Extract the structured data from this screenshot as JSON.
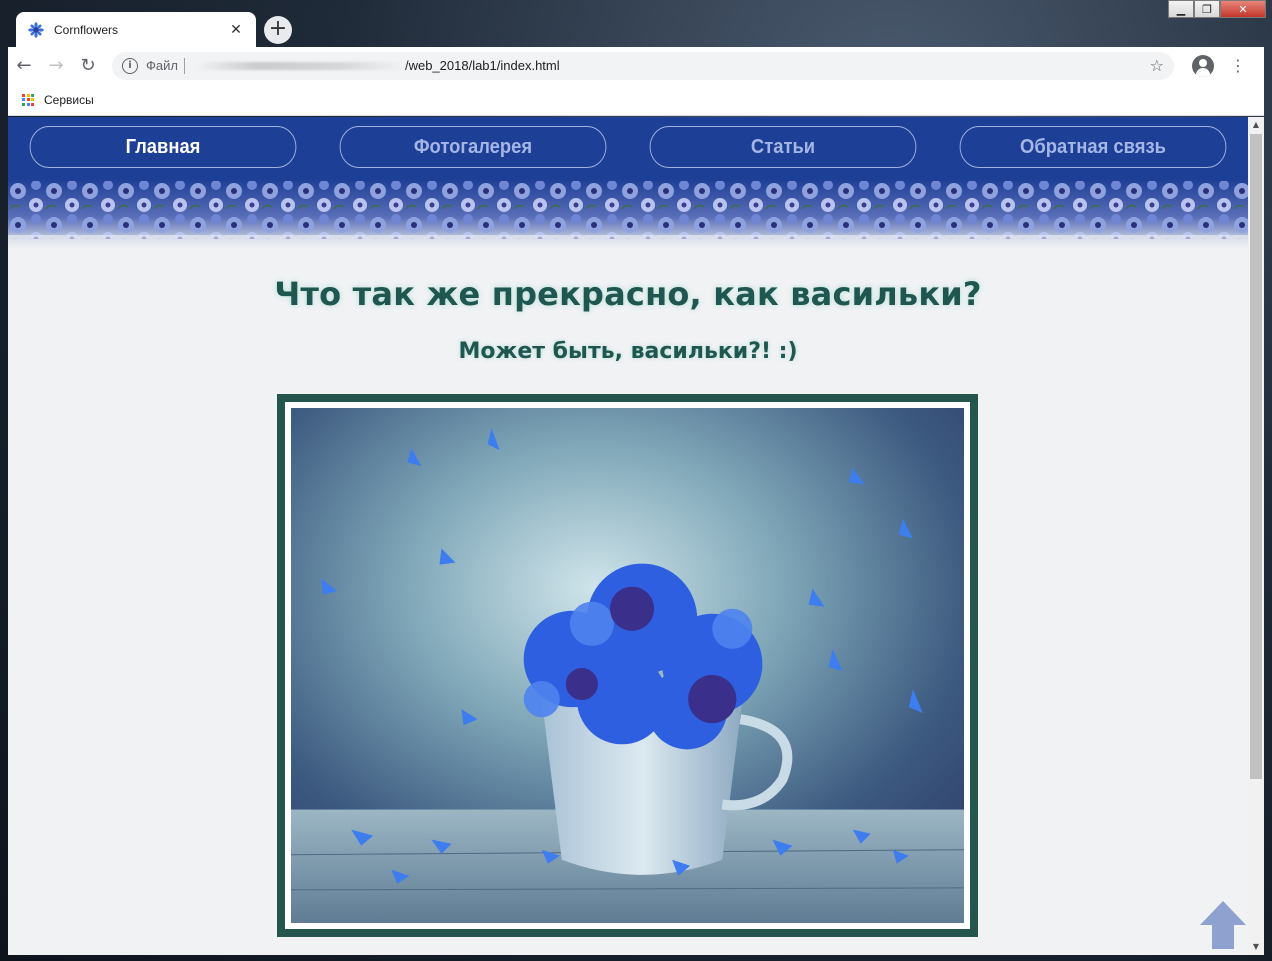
{
  "browser": {
    "tab_title": "Cornflowers",
    "tab_close": "✕",
    "new_tab": "+",
    "scheme_label": "Файл",
    "url": "/web_2018/lab1/index.html",
    "bookmark_label": "Сервисы",
    "window_controls": {
      "minimize": "▁",
      "maximize": "❐",
      "close": "✕"
    }
  },
  "site": {
    "nav": [
      {
        "label": "Главная",
        "active": true
      },
      {
        "label": "Фотогалерея",
        "active": false
      },
      {
        "label": "Статьи",
        "active": false
      },
      {
        "label": "Обратная связь",
        "active": false
      }
    ],
    "heading": "Что так же прекрасно, как васильки?",
    "subheading": "Может быть, васильки?! :)"
  },
  "colors": {
    "header_blue": "#1e3f96",
    "text_green": "#1f5750",
    "frame_green": "#25564e",
    "page_bg": "#f0f2f4"
  }
}
